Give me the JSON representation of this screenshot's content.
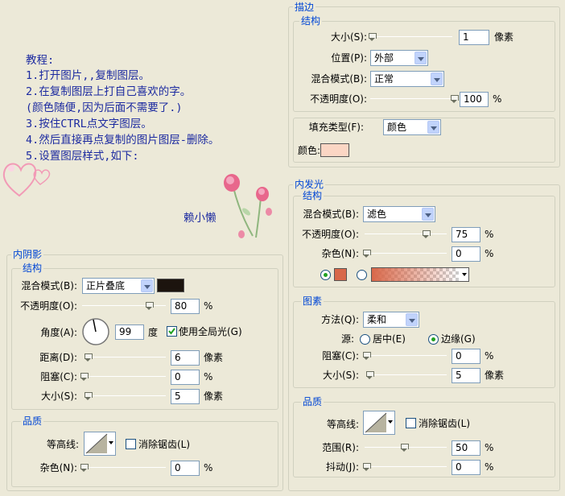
{
  "tutorial": {
    "heading": "教程:",
    "steps": [
      "1.打开图片,,复制图层。",
      "2.在复制图层上打自己喜欢的字。",
      "(颜色随便,因为后面不需要了.)",
      "3.按住CTRL点文字图层。",
      "4.然后直接再点复制的图片图层-删除。",
      "5.设置图层样式,如下:"
    ],
    "author": "赖小懒"
  },
  "stroke": {
    "title": "描边",
    "structure_title": "结构",
    "size_label": "大小(S):",
    "size_value": "1",
    "size_unit": "像素",
    "position_label": "位置(P):",
    "position_value": "外部",
    "blend_label": "混合模式(B):",
    "blend_value": "正常",
    "opacity_label": "不透明度(O):",
    "opacity_value": "100",
    "opacity_unit": "%",
    "fill_type_label": "填充类型(F):",
    "fill_type_value": "颜色",
    "color_label": "颜色:",
    "color": "#fbd6c4"
  },
  "inner_shadow": {
    "title": "内阴影",
    "structure_title": "结构",
    "blend_label": "混合模式(B):",
    "blend_value": "正片叠底",
    "color": "#1c140e",
    "opacity_label": "不透明度(O):",
    "opacity_value": "80",
    "opacity_unit": "%",
    "angle_label": "角度(A):",
    "angle_value": "99",
    "angle_unit": "度",
    "global_light_label": "使用全局光(G)",
    "global_light_checked": true,
    "distance_label": "距离(D):",
    "distance_value": "6",
    "distance_unit": "像素",
    "choke_label": "阻塞(C):",
    "choke_value": "0",
    "choke_unit": "%",
    "size_label": "大小(S):",
    "size_value": "5",
    "size_unit": "像素",
    "quality_title": "品质",
    "contour_label": "等高线:",
    "antialias_label": "消除锯齿(L)",
    "noise_label": "杂色(N):",
    "noise_value": "0",
    "noise_unit": "%"
  },
  "inner_glow": {
    "title": "内发光",
    "structure_title": "结构",
    "blend_label": "混合模式(B):",
    "blend_value": "滤色",
    "opacity_label": "不透明度(O):",
    "opacity_value": "75",
    "opacity_unit": "%",
    "noise_label": "杂色(N):",
    "noise_value": "0",
    "noise_unit": "%",
    "color": "#d8684a",
    "elements_title": "图素",
    "technique_label": "方法(Q):",
    "technique_value": "柔和",
    "source_label": "源:",
    "center_label": "居中(E)",
    "edge_label": "边缘(G)",
    "source_selected": "edge",
    "choke_label": "阻塞(C):",
    "choke_value": "0",
    "choke_unit": "%",
    "size_label": "大小(S):",
    "size_value": "5",
    "size_unit": "像素",
    "quality_title": "品质",
    "contour_label": "等高线:",
    "antialias_label": "消除锯齿(L)",
    "range_label": "范围(R):",
    "range_value": "50",
    "range_unit": "%",
    "jitter_label": "抖动(J):",
    "jitter_value": "0",
    "jitter_unit": "%"
  }
}
